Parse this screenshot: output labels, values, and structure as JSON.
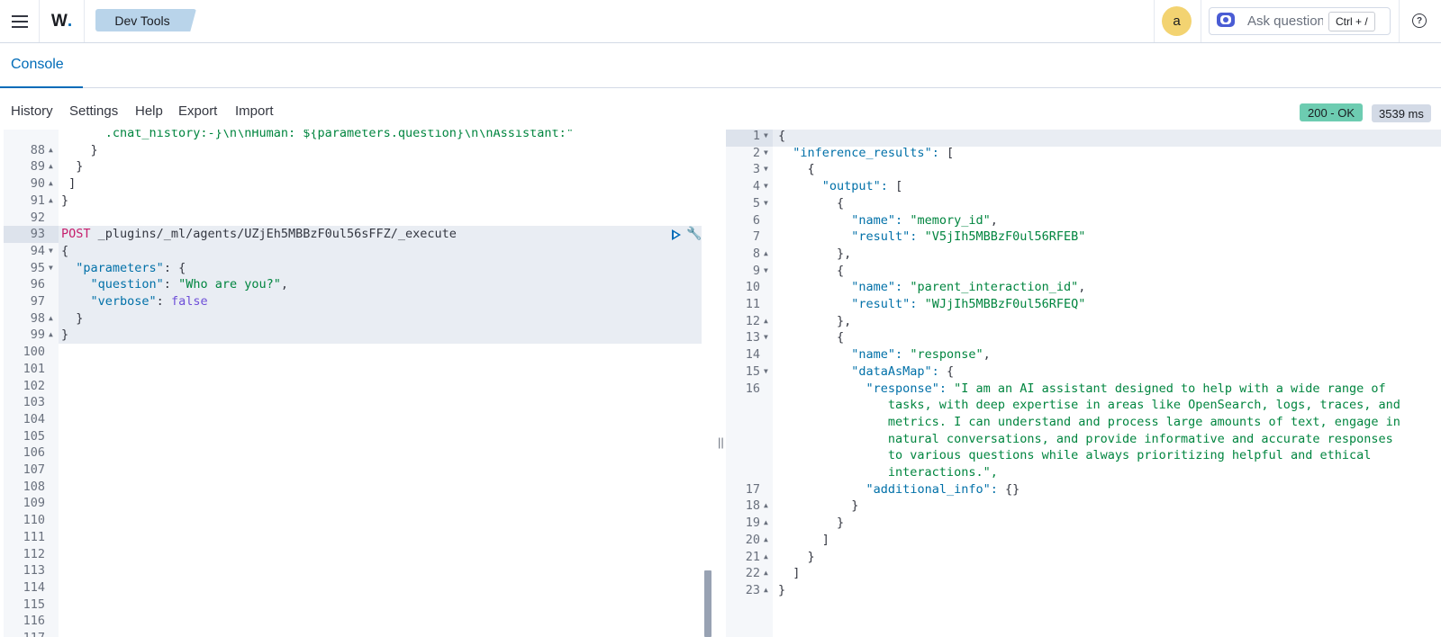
{
  "header": {
    "brand": "W",
    "breadcrumb": "Dev Tools",
    "avatar_initial": "a",
    "ask_placeholder": "Ask question",
    "ask_shortcut": "Ctrl + /",
    "help_glyph": "?"
  },
  "tabs": [
    {
      "label": "Console",
      "active": true
    }
  ],
  "toolbar": {
    "history": "History",
    "settings": "Settings",
    "help": "Help",
    "export": "Export",
    "import": "Import"
  },
  "status": {
    "code": "200 - OK",
    "time": "3539 ms",
    "ok_color": "#6dccb1"
  },
  "request_editor": {
    "lines": [
      {
        "n": "",
        "code": "      .chat_history:-}\\n\\nHuman: ${parameters.question}\\n\\nAssistant:\""
      },
      {
        "n": "88",
        "code": "    }"
      },
      {
        "n": "89",
        "code": "  }"
      },
      {
        "n": "90",
        "code": " ]"
      },
      {
        "n": "91",
        "code": "}"
      },
      {
        "n": "92",
        "code": ""
      },
      {
        "n": "93",
        "method": "POST",
        "code": " _plugins/_ml/agents/UZjEh5MBBzF0ul56sFFZ/_execute"
      },
      {
        "n": "94",
        "code": "{"
      },
      {
        "n": "95",
        "key": "\"parameters\"",
        "code": ": {"
      },
      {
        "n": "96",
        "key": "\"question\"",
        "code": ": ",
        "str": "\"Who are you?\"",
        "tail": ","
      },
      {
        "n": "97",
        "key": "\"verbose\"",
        "code": ": ",
        "bool": "false"
      },
      {
        "n": "98",
        "code": "  }"
      },
      {
        "n": "99",
        "code": "}"
      },
      {
        "n": "100",
        "code": ""
      },
      {
        "n": "101",
        "code": ""
      },
      {
        "n": "102",
        "code": ""
      },
      {
        "n": "103",
        "code": ""
      },
      {
        "n": "104",
        "code": ""
      },
      {
        "n": "105",
        "code": ""
      },
      {
        "n": "106",
        "code": ""
      },
      {
        "n": "107",
        "code": ""
      },
      {
        "n": "108",
        "code": ""
      },
      {
        "n": "109",
        "code": ""
      },
      {
        "n": "110",
        "code": ""
      },
      {
        "n": "111",
        "code": ""
      },
      {
        "n": "112",
        "code": ""
      },
      {
        "n": "113",
        "code": ""
      },
      {
        "n": "114",
        "code": ""
      },
      {
        "n": "115",
        "code": ""
      },
      {
        "n": "116",
        "code": ""
      },
      {
        "n": "117",
        "code": ""
      }
    ]
  },
  "response_viewer": {
    "lines": [
      {
        "n": "1",
        "code": "{"
      },
      {
        "n": "2",
        "code": "  \"inference_results\": ["
      },
      {
        "n": "3",
        "code": "    {"
      },
      {
        "n": "4",
        "code": "      \"output\": ["
      },
      {
        "n": "5",
        "code": "        {"
      },
      {
        "n": "6",
        "code": "          \"name\": \"memory_id\","
      },
      {
        "n": "7",
        "code": "          \"result\": \"V5jIh5MBBzF0ul56RFEB\""
      },
      {
        "n": "8",
        "code": "        },"
      },
      {
        "n": "9",
        "code": "        {"
      },
      {
        "n": "10",
        "code": "          \"name\": \"parent_interaction_id\","
      },
      {
        "n": "11",
        "code": "          \"result\": \"WJjIh5MBBzF0ul56RFEQ\""
      },
      {
        "n": "12",
        "code": "        },"
      },
      {
        "n": "13",
        "code": "        {"
      },
      {
        "n": "14",
        "code": "          \"name\": \"response\","
      },
      {
        "n": "15",
        "code": "          \"dataAsMap\": {"
      },
      {
        "n": "16",
        "code": "            \"response\": \"I am an AI assistant designed to help with a wide range of"
      },
      {
        "n": "",
        "code": "               tasks, with deep expertise in areas like OpenSearch, logs, traces, and"
      },
      {
        "n": "",
        "code": "               metrics. I can understand and process large amounts of text, engage in"
      },
      {
        "n": "",
        "code": "               natural conversations, and provide informative and accurate responses"
      },
      {
        "n": "",
        "code": "               to various questions while always prioritizing helpful and ethical"
      },
      {
        "n": "",
        "code": "               interactions.\","
      },
      {
        "n": "17",
        "code": "            \"additional_info\": {}"
      },
      {
        "n": "18",
        "code": "          }"
      },
      {
        "n": "19",
        "code": "        }"
      },
      {
        "n": "20",
        "code": "      ]"
      },
      {
        "n": "21",
        "code": "    }"
      },
      {
        "n": "22",
        "code": "  ]"
      },
      {
        "n": "23",
        "code": "}"
      }
    ]
  }
}
